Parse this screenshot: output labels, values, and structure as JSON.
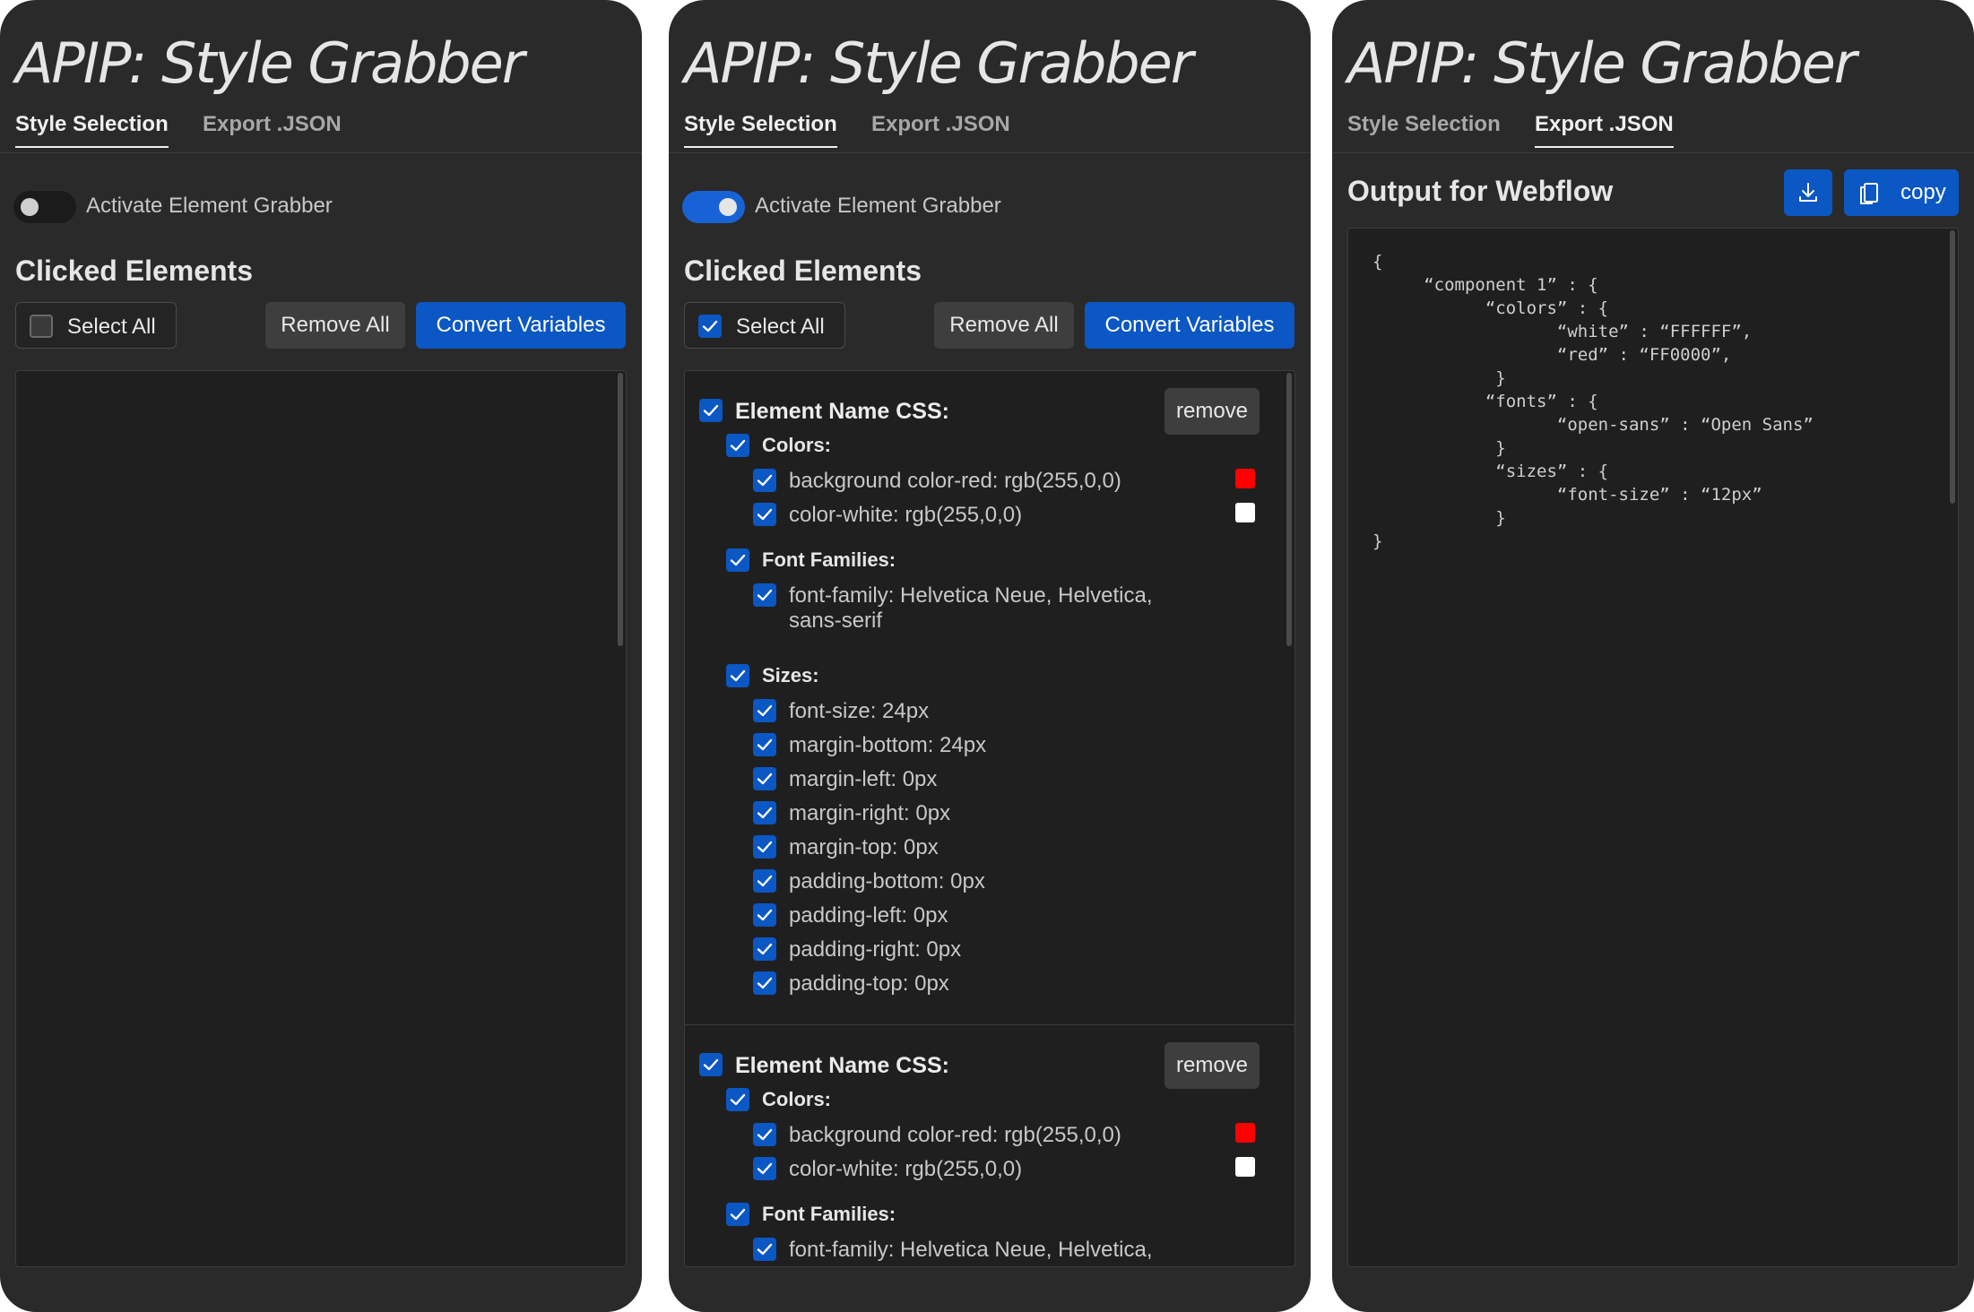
{
  "app": {
    "title": "APIP: Style Grabber",
    "tabs": [
      "Style Selection",
      "Export .JSON"
    ]
  },
  "colors": {
    "panel_bg": "#2a2a2a",
    "list_bg": "#1f1f1f",
    "accent_blue": "#0b57c4",
    "button_gray": "#3e3e3e",
    "swatch_red": "#ff0000",
    "swatch_white": "#ffffff"
  },
  "selection": {
    "toggle_label": "Activate Element Grabber",
    "clicked_heading": "Clicked Elements",
    "select_all_label": "Select All",
    "remove_all_label": "Remove All",
    "convert_label": "Convert Variables"
  },
  "panel1": {
    "active_tab": "Style Selection",
    "toggle_on": false,
    "select_all_checked": false
  },
  "panel2": {
    "active_tab": "Style Selection",
    "toggle_on": true,
    "select_all_checked": true,
    "elements": [
      {
        "name": "Element Name CSS:",
        "remove_label": "remove",
        "groups": {
          "colors_label": "Colors:",
          "colors": [
            "background color-red: rgb(255,0,0)",
            "color-white: rgb(255,0,0)"
          ],
          "fonts_label": "Font Families:",
          "fonts": [
            "font-family: Helvetica Neue, Helvetica,",
            "sans-serif"
          ],
          "sizes_label": "Sizes:",
          "sizes": [
            "font-size: 24px",
            "margin-bottom: 24px",
            "margin-left: 0px",
            "margin-right: 0px",
            "margin-top: 0px",
            "padding-bottom: 0px",
            "padding-left: 0px",
            "padding-right: 0px",
            "padding-top: 0px"
          ]
        }
      },
      {
        "name": "Element Name CSS:",
        "remove_label": "remove",
        "groups": {
          "colors_label": "Colors:",
          "colors": [
            "background color-red: rgb(255,0,0)",
            "color-white: rgb(255,0,0)"
          ],
          "fonts_label": "Font Families:",
          "fonts": [
            "font-family: Helvetica Neue, Helvetica,"
          ]
        }
      }
    ]
  },
  "export": {
    "active_tab": "Export .JSON",
    "output_heading": "Output for Webflow",
    "download_icon": "download-icon",
    "copy_icon": "copy-icon",
    "copy_label": "copy",
    "code": "{\n     “component 1” : {\n           “colors” : {\n                  “white” : “FFFFFF”,\n                  “red” : “FF0000”,\n            }\n           “fonts” : {\n                  “open-sans” : “Open Sans”\n            }\n            “sizes” : {\n                  “font-size” : “12px”\n            }\n}"
  }
}
